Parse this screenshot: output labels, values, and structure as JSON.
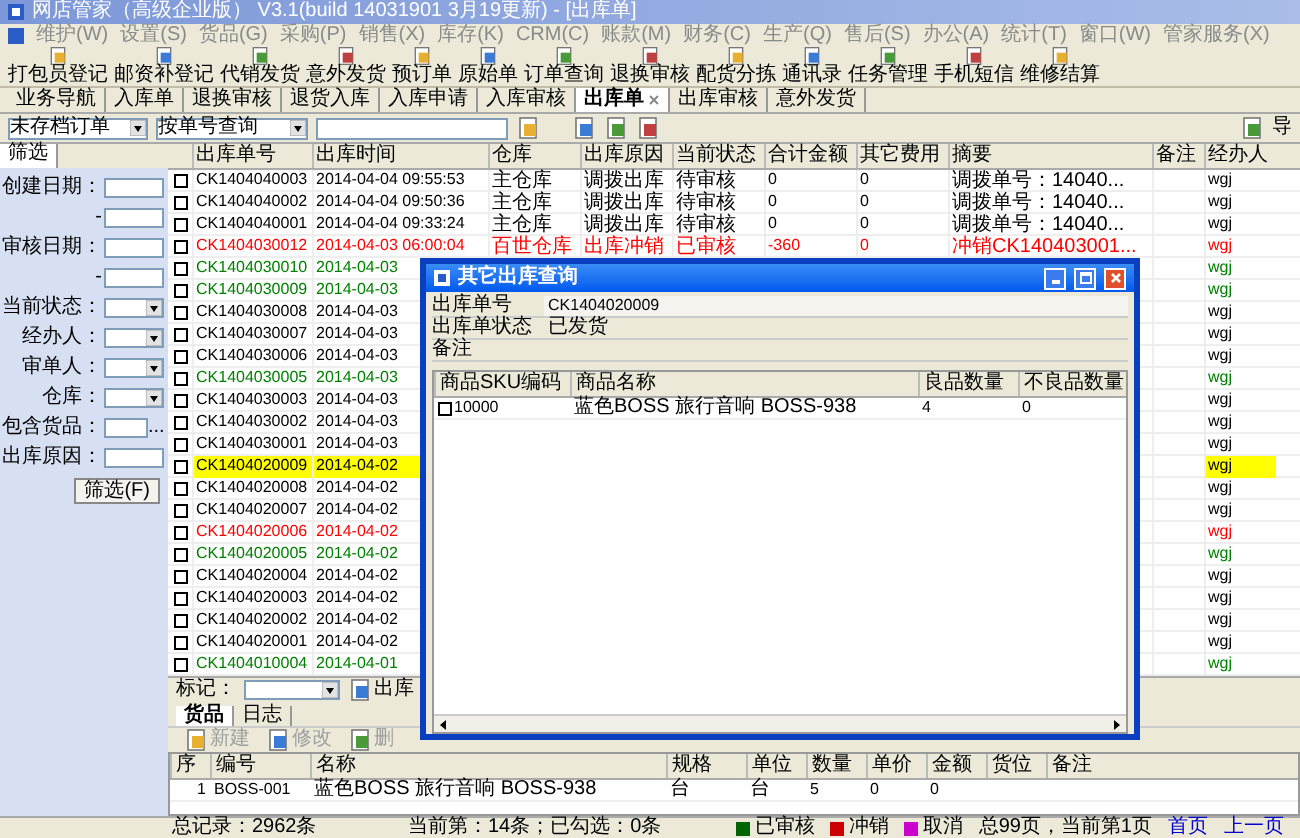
{
  "window": {
    "title": "网店管家（高级企业版） V3.1(build 14031901 3月19更新) - [出库单]"
  },
  "menu": [
    "维护(W)",
    "设置(S)",
    "货品(G)",
    "采购(P)",
    "销售(X)",
    "库存(K)",
    "CRM(C)",
    "账款(M)",
    "财务(C)",
    "生产(Q)",
    "售后(S)",
    "办公(A)",
    "统计(T)",
    "窗口(W)",
    "管家服务(X)"
  ],
  "toolbar": [
    "打包员登记",
    "邮资补登记",
    "代销发货",
    "意外发货",
    "预订单",
    "原始单",
    "订单查询",
    "退换审核",
    "配货分拣",
    "通讯录",
    "任务管理",
    "手机短信",
    "维修结算"
  ],
  "tabs": [
    {
      "label": "业务导航",
      "selected": false
    },
    {
      "label": "入库单",
      "selected": false
    },
    {
      "label": "退换审核",
      "selected": false
    },
    {
      "label": "退货入库",
      "selected": false
    },
    {
      "label": "入库申请",
      "selected": false
    },
    {
      "label": "入库审核",
      "selected": false
    },
    {
      "label": "出库单",
      "selected": true
    },
    {
      "label": "出库审核",
      "selected": false
    },
    {
      "label": "意外发货",
      "selected": false
    }
  ],
  "filter_bar": {
    "archive_select": "未存档订单",
    "query_select": "按单号查询",
    "side_label": "导"
  },
  "filter_panel": {
    "tab": "筛选",
    "fields": [
      {
        "kind": "input",
        "label": "创建日期："
      },
      {
        "kind": "input",
        "label": "-"
      },
      {
        "kind": "input",
        "label": "审核日期："
      },
      {
        "kind": "input",
        "label": "-"
      },
      {
        "kind": "select",
        "label": "当前状态："
      },
      {
        "kind": "select",
        "label": "经办人："
      },
      {
        "kind": "select",
        "label": "审单人："
      },
      {
        "kind": "select",
        "label": "仓库："
      },
      {
        "kind": "picker",
        "label": "包含货品：",
        "button": "..."
      },
      {
        "kind": "input",
        "label": "出库原因："
      }
    ],
    "button": "筛选(F)"
  },
  "table": {
    "columns": [
      "出库单号",
      "出库时间",
      "仓库",
      "出库原因",
      "当前状态",
      "合计金额",
      "其它费用",
      "摘要",
      "备注",
      "经办人"
    ],
    "rows": [
      {
        "checked": false,
        "selected": false,
        "color": "#000000",
        "order_no": "CK1404040003",
        "time": "2014-04-04  09:55:53",
        "warehouse": "主仓库",
        "reason": "调拨出库",
        "status": "待审核",
        "total": "0",
        "other_fees": "0",
        "summary": "调拨单号：14040...",
        "handler": "wgj"
      },
      {
        "checked": false,
        "selected": false,
        "color": "#000000",
        "order_no": "CK1404040002",
        "time": "2014-04-04  09:50:36",
        "warehouse": "主仓库",
        "reason": "调拨出库",
        "status": "待审核",
        "total": "0",
        "other_fees": "0",
        "summary": "调拨单号：14040...",
        "handler": "wgj"
      },
      {
        "checked": false,
        "selected": false,
        "color": "#000000",
        "order_no": "CK1404040001",
        "time": "2014-04-04  09:33:24",
        "warehouse": "主仓库",
        "reason": "调拨出库",
        "status": "待审核",
        "total": "0",
        "other_fees": "0",
        "summary": "调拨单号：14040...",
        "handler": "wgj"
      },
      {
        "checked": false,
        "selected": false,
        "color": "#ff0000",
        "order_no": "CK1404030012",
        "time": "2014-04-03  06:00:04",
        "warehouse": "百世仓库",
        "reason": "出库冲销",
        "status": "已审核",
        "total": "-360",
        "other_fees": "0",
        "summary": "冲销CK140403001...",
        "handler": "wgj"
      },
      {
        "checked": false,
        "selected": false,
        "color": "#008000",
        "order_no": "CK1404030010",
        "time": "2014-04-03",
        "handler": "wgj"
      },
      {
        "checked": false,
        "selected": false,
        "color": "#008000",
        "order_no": "CK1404030009",
        "time": "2014-04-03",
        "handler": "wgj"
      },
      {
        "checked": false,
        "selected": false,
        "color": "#000000",
        "order_no": "CK1404030008",
        "time": "2014-04-03",
        "handler": "wgj"
      },
      {
        "checked": false,
        "selected": false,
        "color": "#000000",
        "order_no": "CK1404030007",
        "time": "2014-04-03",
        "handler": "wgj"
      },
      {
        "checked": false,
        "selected": false,
        "color": "#000000",
        "order_no": "CK1404030006",
        "time": "2014-04-03",
        "handler": "wgj"
      },
      {
        "checked": false,
        "selected": false,
        "color": "#008000",
        "order_no": "CK1404030005",
        "time": "2014-04-03",
        "handler": "wgj"
      },
      {
        "checked": false,
        "selected": false,
        "color": "#000000",
        "order_no": "CK1404030003",
        "time": "2014-04-03",
        "handler": "wgj"
      },
      {
        "checked": false,
        "selected": false,
        "color": "#000000",
        "order_no": "CK1404030002",
        "time": "2014-04-03",
        "handler": "wgj"
      },
      {
        "checked": false,
        "selected": false,
        "color": "#000000",
        "order_no": "CK1404030001",
        "time": "2014-04-03",
        "handler": "wgj"
      },
      {
        "checked": false,
        "selected": true,
        "color": "#000000",
        "order_no": "CK1404020009",
        "time": "2014-04-02",
        "handler": "wgj"
      },
      {
        "checked": false,
        "selected": false,
        "color": "#000000",
        "order_no": "CK1404020008",
        "time": "2014-04-02",
        "handler": "wgj"
      },
      {
        "checked": false,
        "selected": false,
        "color": "#000000",
        "order_no": "CK1404020007",
        "time": "2014-04-02",
        "handler": "wgj"
      },
      {
        "checked": false,
        "selected": false,
        "color": "#ff0000",
        "order_no": "CK1404020006",
        "time": "2014-04-02",
        "handler": "wgj"
      },
      {
        "checked": false,
        "selected": false,
        "color": "#008000",
        "order_no": "CK1404020005",
        "time": "2014-04-02",
        "handler": "wgj"
      },
      {
        "checked": false,
        "selected": false,
        "color": "#000000",
        "order_no": "CK1404020004",
        "time": "2014-04-02",
        "handler": "wgj"
      },
      {
        "checked": false,
        "selected": false,
        "color": "#000000",
        "order_no": "CK1404020003",
        "time": "2014-04-02",
        "handler": "wgj"
      },
      {
        "checked": false,
        "selected": false,
        "color": "#000000",
        "order_no": "CK1404020002",
        "time": "2014-04-02",
        "handler": "wgj"
      },
      {
        "checked": false,
        "selected": false,
        "color": "#000000",
        "order_no": "CK1404020001",
        "time": "2014-04-02",
        "handler": "wgj"
      },
      {
        "checked": false,
        "selected": false,
        "color": "#008000",
        "order_no": "CK1404010004",
        "time": "2014-04-01",
        "handler": "wgj"
      }
    ]
  },
  "mark_bar": {
    "label": "标记：",
    "action": "出库"
  },
  "detail_tabs": [
    {
      "label": "货品",
      "selected": true
    },
    {
      "label": "日志",
      "selected": false
    }
  ],
  "detail_actions": [
    {
      "label": "新建",
      "disabled": true
    },
    {
      "label": "修改",
      "disabled": true
    },
    {
      "label": "删",
      "disabled": true
    }
  ],
  "detail_table": {
    "columns": [
      "序",
      "编号",
      "名称",
      "规格",
      "单位",
      "数量",
      "单价",
      "金额",
      "货位",
      "备注"
    ],
    "rows": [
      [
        "1",
        "BOSS-001",
        "蓝色BOSS 旅行音响 BOSS-938",
        "台",
        "台",
        "5",
        "0",
        "0"
      ]
    ]
  },
  "dialog": {
    "title": "其它出库查询",
    "fields": [
      {
        "label": "出库单号",
        "value": "CK1404020009"
      },
      {
        "label": "出库单状态",
        "value": "已发货"
      },
      {
        "label": "备注"
      }
    ],
    "columns": [
      "商品SKU编码",
      "商品名称",
      "良品数量",
      "不良品数量"
    ],
    "rows": [
      {
        "checked": false,
        "cells": [
          "10000",
          "蓝色BOSS 旅行音响 BOSS-938",
          "4",
          "0"
        ]
      }
    ]
  },
  "status_bar": {
    "total": "总记录：2962条",
    "current": "当前第：14条；已勾选：0条",
    "legend": [
      {
        "label": "已审核",
        "color": "#006400"
      },
      {
        "label": "冲销",
        "color": "#cc0000"
      },
      {
        "label": "取消",
        "color": "#cc00cc"
      }
    ],
    "pages": "总99页，当前第1页",
    "links": [
      "首页",
      "上一页"
    ]
  }
}
